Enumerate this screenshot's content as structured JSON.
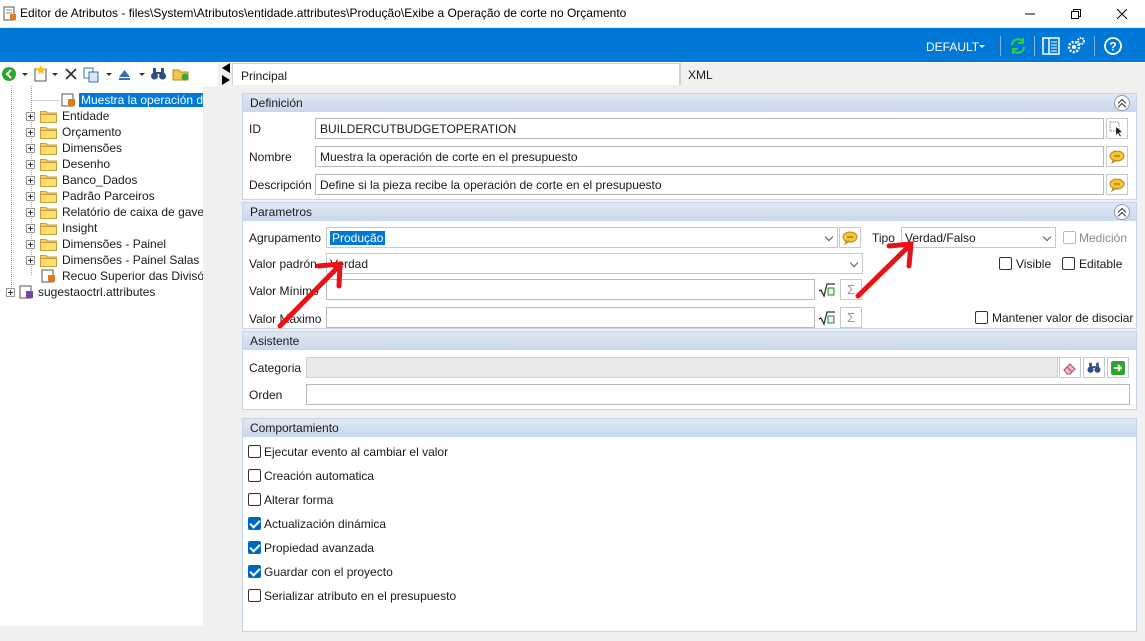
{
  "window": {
    "title": "Editor de Atributos - files\\System\\Atributos\\entidade.attributes\\Produção\\Exibe a Operação de corte no Orçamento"
  },
  "topbar": {
    "profile": "DEFAULT"
  },
  "tree": {
    "selected": "Muestra la operación de",
    "items": [
      "Entidade",
      "Orçamento",
      "Dimensões",
      "Desenho",
      "Banco_Dados",
      "Padrão Parceiros",
      "Relatório de caixa de gaveta",
      "Insight",
      "Dimensões - Painel",
      "Dimensões - Painel Salas"
    ],
    "leaf": "Recuo Superior das Divisór",
    "root2": "sugestaoctrl.attributes"
  },
  "tabs": {
    "principal": "Principal",
    "xml": "XML"
  },
  "definicion": {
    "header": "Definición",
    "id_label": "ID",
    "id_value": "BUILDERCUTBUDGETOPERATION",
    "nombre_label": "Nombre",
    "nombre_value": "Muestra la operación de corte en el presupuesto",
    "descripcion_label": "Descripción",
    "descripcion_value": "Define si la pieza recibe la operación de corte en el presupuesto"
  },
  "parametros": {
    "header": "Parametros",
    "agrupamento_label": "Agrupamento",
    "agrupamento_value": "Produção",
    "tipo_label": "Tipo",
    "tipo_value": "Verdad/Falso",
    "medicion_label": "Medición",
    "valor_padron_label": "Valor padrón",
    "valor_padron_value": "Verdad",
    "visible_label": "Visible",
    "editable_label": "Editable",
    "valor_minimo_label": "Valor Mínimo",
    "valor_maximo_label": "Valor Máximo",
    "mantener_label": "Mantener valor de disociar"
  },
  "asistente": {
    "header": "Asistente",
    "categoria_label": "Categoria",
    "orden_label": "Orden"
  },
  "comportamiento": {
    "header": "Comportamiento",
    "options": [
      {
        "label": "Ejecutar evento al cambiar el valor",
        "checked": false
      },
      {
        "label": "Creación automatica",
        "checked": false
      },
      {
        "label": "Alterar forma",
        "checked": false
      },
      {
        "label": "Actualización dinámica",
        "checked": true
      },
      {
        "label": "Propiedad avanzada",
        "checked": true
      },
      {
        "label": "Guardar con el proyecto",
        "checked": true
      },
      {
        "label": "Serializar atributo en el presupuesto",
        "checked": false
      }
    ]
  },
  "colors": {
    "accent": "#0078d7",
    "annotation": "#e8121a",
    "group_header": "#c9d8ec"
  }
}
